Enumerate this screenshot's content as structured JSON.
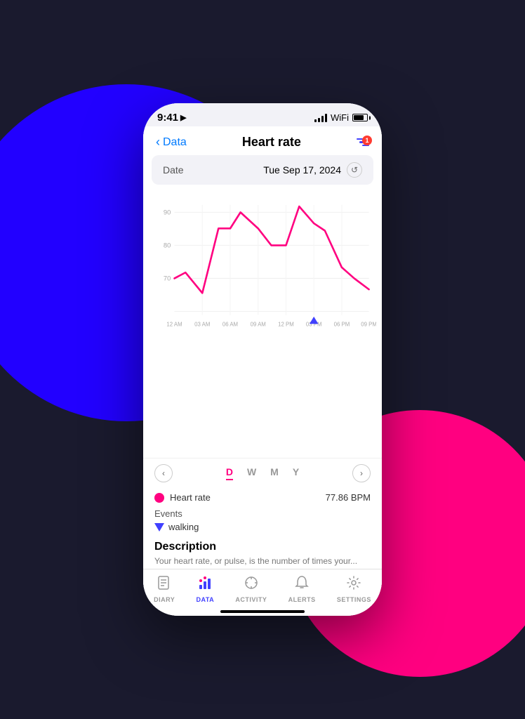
{
  "background": {
    "circle_blue": "#2200ff",
    "circle_pink": "#ff0080"
  },
  "status_bar": {
    "time": "9:41",
    "location_arrow": "▲",
    "battery_percent": 80
  },
  "nav": {
    "back_label": "Data",
    "title": "Heart rate",
    "filter_badge": "1"
  },
  "date_row": {
    "label": "Date",
    "value": "Tue Sep 17, 2024",
    "refresh_icon": "↺"
  },
  "chart": {
    "y_labels": [
      "90",
      "80",
      "70"
    ],
    "x_labels": [
      "12 AM",
      "03 AM",
      "06 AM",
      "09 AM",
      "12 PM",
      "03 PM",
      "06 PM",
      "09 PM"
    ],
    "accent_color": "#ff0080",
    "grid_color": "#f0f0f0",
    "event_marker_color": "#4040ff",
    "event_marker_x": "03 PM"
  },
  "period_selector": {
    "prev_icon": "‹",
    "next_icon": "›",
    "tabs": [
      {
        "label": "D",
        "active": true
      },
      {
        "label": "W",
        "active": false
      },
      {
        "label": "M",
        "active": false
      },
      {
        "label": "Y",
        "active": false
      }
    ]
  },
  "legend": {
    "heart_rate": {
      "label": "Heart rate",
      "value": "77.86 BPM",
      "color": "#ff0080"
    }
  },
  "events": {
    "label": "Events",
    "items": [
      {
        "name": "walking",
        "color": "#4040ff"
      }
    ]
  },
  "description": {
    "title": "Description",
    "text": "Your heart rate, or pulse, is the number of times your..."
  },
  "tab_bar": {
    "tabs": [
      {
        "label": "DIARY",
        "icon": "📋",
        "active": false
      },
      {
        "label": "DATA",
        "icon": "📊",
        "active": true
      },
      {
        "label": "ACTIVITY",
        "icon": "☀",
        "active": false
      },
      {
        "label": "ALERTS",
        "icon": "🔔",
        "active": false
      },
      {
        "label": "SETTINGS",
        "icon": "⚙",
        "active": false
      }
    ]
  }
}
